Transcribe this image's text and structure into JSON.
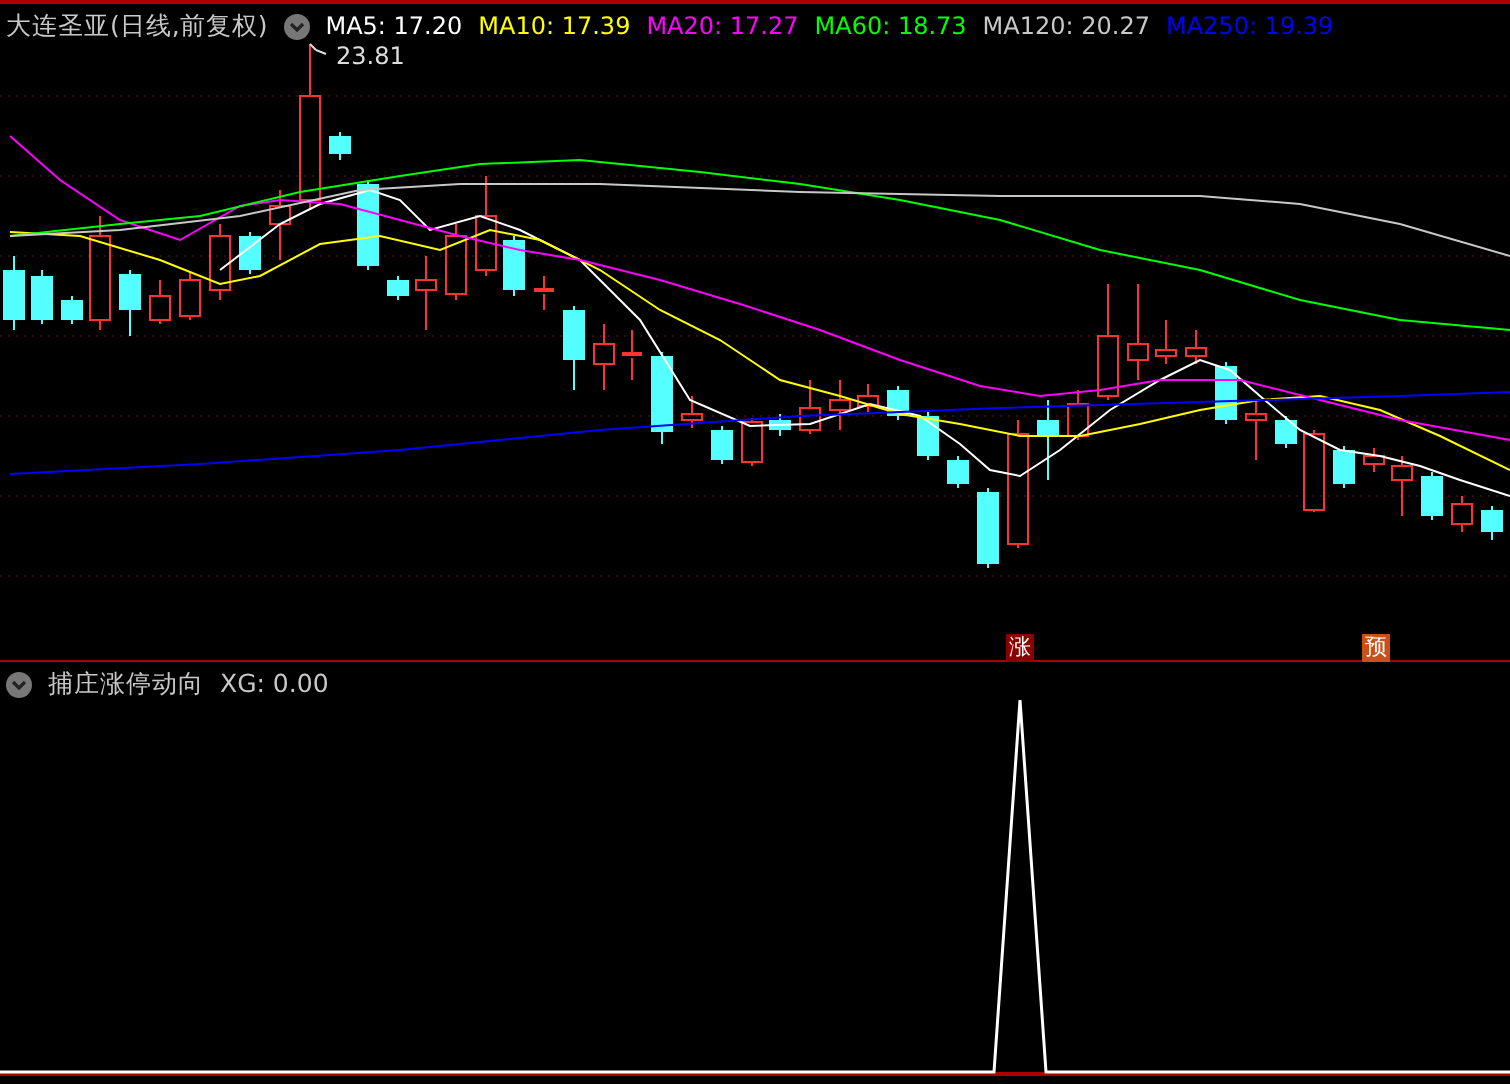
{
  "main_panel": {
    "title": "大连圣亚(日线,前复权)",
    "legend": [
      {
        "label": "MA5: 17.20",
        "color": "#ffffff"
      },
      {
        "label": "MA10: 17.39",
        "color": "#ffff00"
      },
      {
        "label": "MA20: 17.27",
        "color": "#ff00ff"
      },
      {
        "label": "MA60: 18.73",
        "color": "#00ff00"
      },
      {
        "label": "MA120: 20.27",
        "color": "#c8c8c8"
      },
      {
        "label": "MA250: 19.39",
        "color": "#0000ff"
      }
    ],
    "high_label": "23.81",
    "signals": [
      {
        "text": "涨",
        "color": "#8b0000"
      },
      {
        "text": "预",
        "color": "#c8501a"
      }
    ]
  },
  "indicator_panel": {
    "title": "捕庄涨停动向",
    "value": "XG: 0.00"
  }
}
